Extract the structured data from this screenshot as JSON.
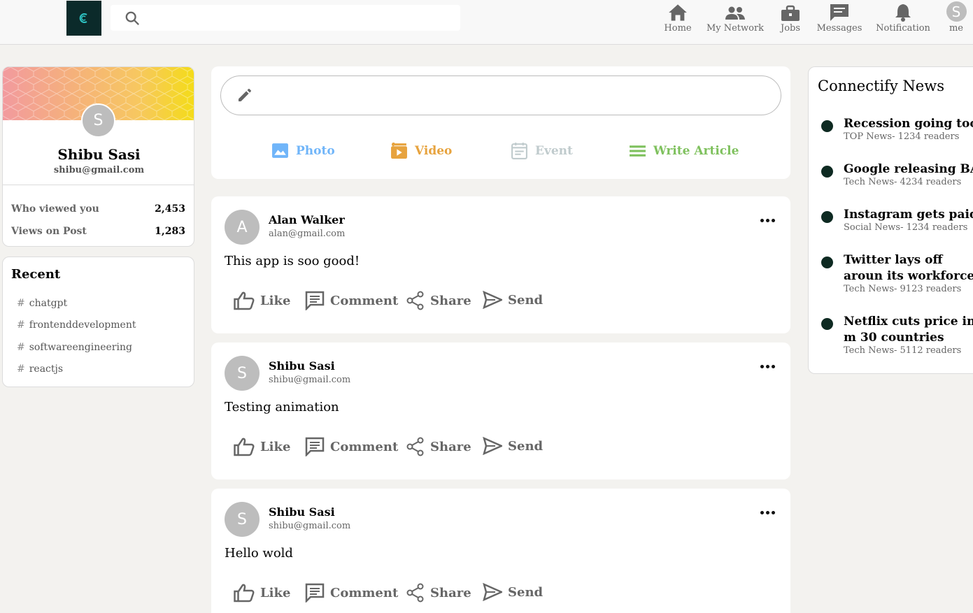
{
  "header": {
    "search_placeholder": "",
    "nav": [
      {
        "label": "Home",
        "icon": "home-icon"
      },
      {
        "label": "My Network",
        "icon": "people-icon"
      },
      {
        "label": "Jobs",
        "icon": "briefcase-icon"
      },
      {
        "label": "Messages",
        "icon": "message-icon"
      },
      {
        "label": "Notification",
        "icon": "bell-icon"
      },
      {
        "label": "me",
        "icon": "avatar",
        "initial": "S"
      }
    ]
  },
  "profile": {
    "initial": "S",
    "name": "Shibu Sasi",
    "email": "shibu@gmail.com",
    "stats": [
      {
        "label": "Who viewed you",
        "value": "2,453"
      },
      {
        "label": "Views on Post",
        "value": "1,283"
      }
    ]
  },
  "recent": {
    "title": "Recent",
    "tags": [
      "chatgpt",
      "frontenddevelopment",
      "softwareengineering",
      "reactjs"
    ]
  },
  "composer": {
    "placeholder": "",
    "actions": [
      {
        "label": "Photo",
        "color": "#70b5f9",
        "icon": "photo-icon"
      },
      {
        "label": "Video",
        "color": "#e7a33e",
        "icon": "video-icon"
      },
      {
        "label": "Event",
        "color": "#c0cbcd",
        "icon": "calendar-icon"
      },
      {
        "label": "Write Article",
        "color": "#7fc15e",
        "icon": "article-icon"
      }
    ]
  },
  "post_actions": [
    "Like",
    "Comment",
    "Share",
    "Send"
  ],
  "posts": [
    {
      "initial": "A",
      "name": "Alan Walker",
      "email": "alan@gmail.com",
      "text": "This app is soo good!"
    },
    {
      "initial": "S",
      "name": "Shibu Sasi",
      "email": "shibu@gmail.com",
      "text": "Testing animation"
    },
    {
      "initial": "S",
      "name": "Shibu Sasi",
      "email": "shibu@gmail.com",
      "text": "Hello wold"
    }
  ],
  "news": {
    "title": "Connectify News",
    "items": [
      {
        "title": "Recession going too fa",
        "sub": "TOP News- 1234 readers"
      },
      {
        "title": "Google releasing BAR",
        "sub": "Tech News- 4234 readers"
      },
      {
        "title": "Instagram gets paid v",
        "sub": "Social News- 1234 readers"
      },
      {
        "title": "Twitter lays off aroun its workforce",
        "sub": "Tech News- 9123 readers"
      },
      {
        "title": "Netflix cuts price in m 30 countries",
        "sub": "Tech News- 5112 readers"
      }
    ]
  }
}
